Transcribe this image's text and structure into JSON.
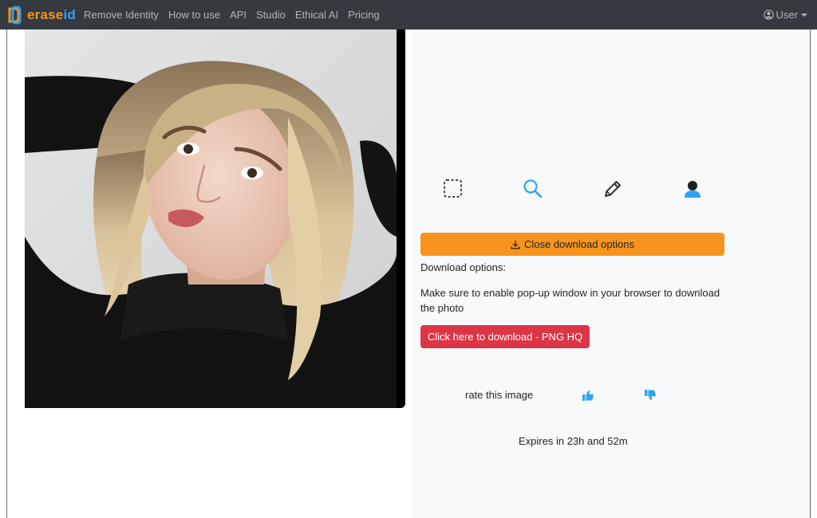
{
  "brand": {
    "name_part1": "erase",
    "name_part2": "id"
  },
  "nav": {
    "links": [
      "Remove Identity",
      "How to use",
      "API",
      "Studio",
      "Ethical AI",
      "Pricing"
    ],
    "user_label": "User"
  },
  "toolbar": {
    "icons": [
      "select-icon",
      "search-icon",
      "pencil-icon",
      "user-silhouette-icon"
    ]
  },
  "download": {
    "toggle_label": "Close download options",
    "options_label": "Download options:",
    "note": "Make sure to enable pop-up window in your browser to download the photo",
    "download_button_label": "Click here to download - PNG HQ"
  },
  "rating": {
    "label": "rate this image",
    "icons": [
      "thumbs-up-icon",
      "thumbs-down-icon"
    ]
  },
  "expires_text": "Expires in 23h and 52m",
  "colors": {
    "navbar": "#343a40",
    "accent_orange": "#f7941d",
    "accent_blue": "#2ea3f2",
    "danger_red": "#dc3545",
    "panel_bg": "#f8f9fa"
  }
}
